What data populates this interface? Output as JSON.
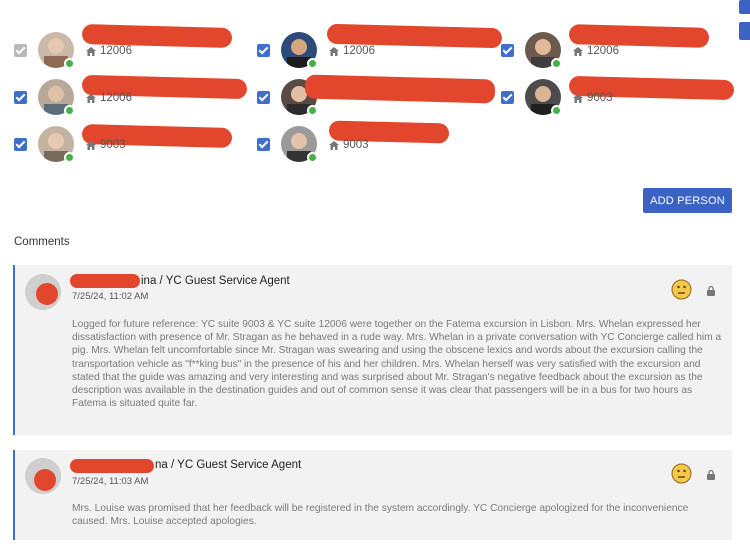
{
  "people": [
    {
      "room": "12006",
      "checked": false
    },
    {
      "room": "12006",
      "checked": true
    },
    {
      "room": "12006",
      "checked": true
    },
    {
      "room": "12006",
      "checked": true
    },
    {
      "room": "9003",
      "checked": true
    },
    {
      "room": "9003",
      "checked": true
    },
    {
      "room": "9003",
      "checked": true
    },
    {
      "room": "9003",
      "checked": true
    }
  ],
  "add_person_label": "ADD PERSON",
  "comments_title": "Comments",
  "comments": [
    {
      "author": "ina / YC Guest Service Agent",
      "date": "7/25/24, 11:02 AM",
      "text": "Logged for future reference: YC suite 9003 & YC suite 12006 were together on the Fatema excursion in Lisbon. Mrs. Whelan expressed her dissatisfaction with presence of Mr. Stragan as he behaved in a rude way. Mrs. Whelan in a private conversation with YC Concierge called him a pig. Mrs. Whelan felt uncomfortable since Mr. Stragan was swearing and using the obscene lexics and words about the excursion calling the transportation vehicle as \"f**king bus\" in the presence of his and her children. Mrs. Whelan herself was very satisfied with the excursion and stated that the guide was amazing and very interesting and was surprised about Mr. Stragan's negative feedback about the excursion as the description was available in the destination guides and out of common sense it was clear that passengers will be in a bus for two hours as Fatema is situated quite far."
    },
    {
      "author": "na / YC Guest Service Agent",
      "date": "7/25/24, 11:03 AM",
      "text": "Mrs. Louise was promised that her feedback will be registered in the system accordingly. YC Concierge apologized for the inconvenience caused. Mrs. Louise accepted apologies."
    }
  ],
  "colors": {
    "accent": "#3f6ecb",
    "button": "#3a63c4",
    "redaction": "#e2472d",
    "online": "#43b04a",
    "card_bg": "#f2f2f2"
  },
  "icons": {
    "room": "home-icon",
    "mood": "neutral-face-icon",
    "privacy": "lock-icon"
  }
}
